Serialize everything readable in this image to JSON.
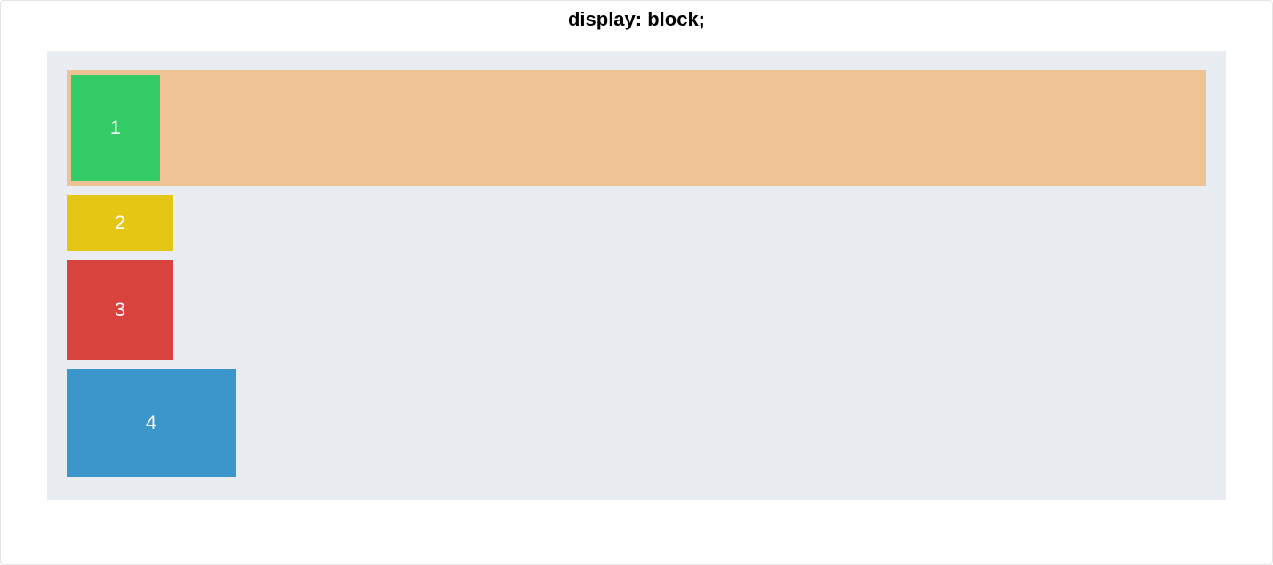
{
  "title": "display: block;",
  "colors": {
    "container_bg": "#e9edf1",
    "highlight_bg": "#eec395",
    "box1": "#33cc66",
    "box2": "#e6c614",
    "box3": "#d9433d",
    "box4": "#3b96cc"
  },
  "boxes": [
    {
      "label": "1",
      "color_key": "box1"
    },
    {
      "label": "2",
      "color_key": "box2"
    },
    {
      "label": "3",
      "color_key": "box3"
    },
    {
      "label": "4",
      "color_key": "box4"
    }
  ]
}
